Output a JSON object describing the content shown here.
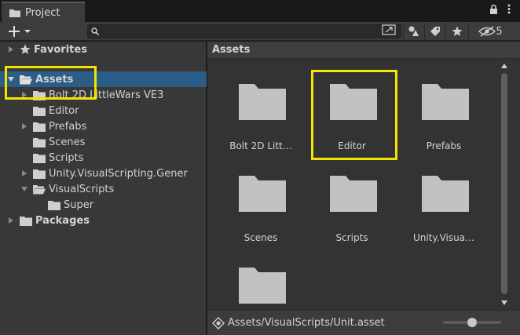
{
  "window": {
    "tab_title": "Project",
    "hidden_count": "5"
  },
  "toolbar": {
    "search_placeholder": ""
  },
  "tree": {
    "favorites": "Favorites",
    "assets": "Assets",
    "children": [
      "Bolt 2D LittleWars VE3",
      "Editor",
      "Prefabs",
      "Scenes",
      "Scripts",
      "Unity.VisualScripting.Gener",
      "VisualScripts"
    ],
    "super": "Super",
    "packages": "Packages"
  },
  "grid": {
    "header": "Assets",
    "items": [
      "Bolt 2D Litt…",
      "Editor",
      "Prefabs",
      "Scenes",
      "Scripts",
      "Unity.Visua…",
      ""
    ]
  },
  "status": {
    "path": "Assets/VisualScripts/Unit.asset",
    "zoom_level": 0.5
  },
  "colors": {
    "selection": "#2c5d87",
    "highlight": "#f2e600",
    "folder": "#c2c2c2"
  }
}
